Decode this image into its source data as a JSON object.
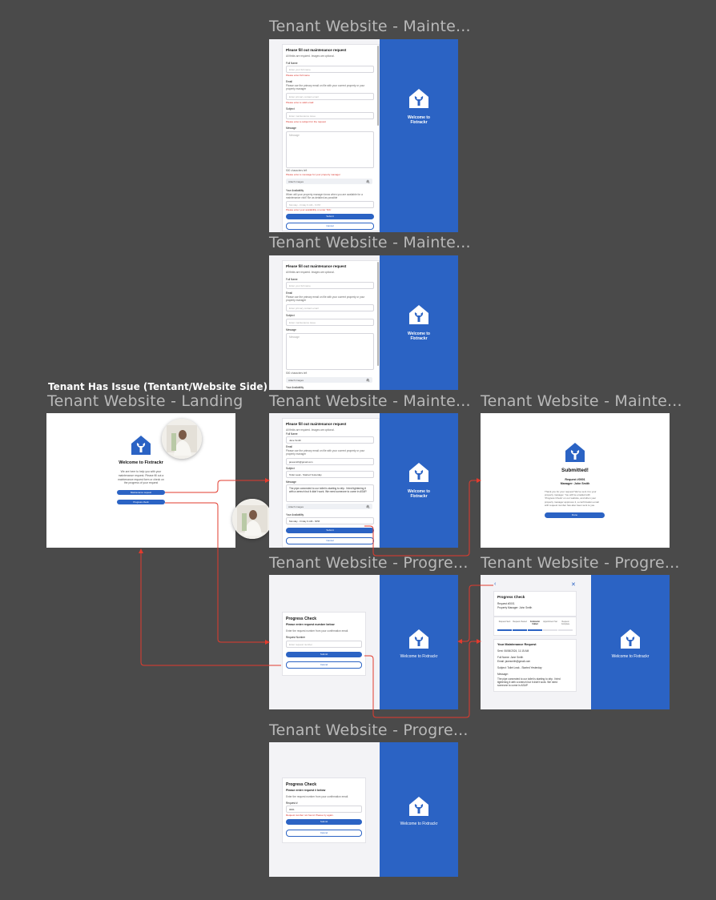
{
  "section_title": "Tenant Has Issue (Tentant/Website Side)",
  "frames": {
    "maint1": "Tenant Website - Mainte...",
    "maint2": "Tenant Website - Mainte...",
    "landing": "Tenant Website - Landing",
    "maint3": "Tenant Website - Mainte...",
    "maint_submitted": "Tenant Website - Mainte...",
    "progress1": "Tenant Website - Progre...",
    "progress2": "Tenant Website - Progre...",
    "progress3": "Tenant Website - Progre..."
  },
  "brand": {
    "welcome_line1": "Welcome to",
    "welcome_line2": "Fixtrackr",
    "welcome_full": "Welcome to Fixtrackr",
    "accent": "#2b63c4"
  },
  "landing": {
    "title": "Welcome to Fixtrackr",
    "body": [
      "We are here to help you with your",
      "maintenance request. Please fill out a",
      "maintenance request form or check on",
      "the progress of your request"
    ],
    "btn_request": "Maintenance request",
    "btn_progress": "Progress check"
  },
  "maint_form": {
    "heading": "Please fill out maintenance request",
    "subheading": "All fields are required. Images are optional.",
    "full_name_label": "Full Name",
    "full_name_placeholder": "Enter your full name",
    "full_name_error": "Please enter full name",
    "full_name_value": "Jane Smith",
    "email_label": "Email",
    "email_hint": "Please use the primary email on file with your current property or your property manager",
    "email_placeholder": "Enter primary contact email",
    "email_error": "Please enter a valid email",
    "email_value": "janesmith@gmail.com",
    "subject_label": "Subject",
    "subject_placeholder": "Enter maintenance issue",
    "subject_error": "Please enter a subject for the request",
    "subject_value": "Toilet Leak - Started Yesterday",
    "message_label": "Message",
    "message_placeholder": "Message",
    "message_value": "The pipe connected to our toilet is starting to drip. I tried tightening it with a wrench but it didn't work. We need someone to come in ASAP.",
    "char_count": "500 characters left",
    "message_error": "Please enter a message for your property manager",
    "attach_label": "Attach images",
    "availability_label": "Your Availability",
    "availability_hint": "When will your property manager know when you are available for a maintenance visit? Be as detailed as possible",
    "availability_placeholder": "Monday - Friday 9 AM - 6 PM",
    "availability_value": "Monday - Friday 9 AM - 6PM",
    "availability_error": "Please enter your availability or enter 'N/A'",
    "submit": "Submit",
    "cancel": "Cancel"
  },
  "submitted": {
    "title": "Submitted!",
    "request": "Request #0001",
    "manager": "Manager: John Smith",
    "body": [
      "Thank you for your request! We've sent it to your",
      "property manager. You will be emailed with",
      "'Progress Check' on our website, and when your",
      "property manager approves it, a confirmation email",
      "with request number has also been sent to you."
    ],
    "done": "Done"
  },
  "progress": {
    "heading": "Progress Check",
    "subheading": "Please enter request number below",
    "subheading_alt": "Please enter request # below",
    "hint": "Enter the request number from your confirmation email.",
    "label": "Request Number",
    "label_alt": "Request #",
    "placeholder": "Enter request number",
    "error_value": "0001",
    "error": "Request number not found. Please try again.",
    "submit": "Submit",
    "cancel": "Cancel"
  },
  "progress_detail": {
    "heading": "Progress Check",
    "request": "Request #0001",
    "manager": "Property Manager: John Smith",
    "steps": [
      "Request Sent",
      "Request Viewed",
      "Contractor Called",
      "Appointment Set",
      "Request Complete"
    ],
    "steps_done": 3,
    "section": "Your Maintenance Request",
    "sent": "Sent: 06/06/2024, 11:15 AM",
    "name": "Full Name: Jane Smith",
    "email": "Email: janesmith@gmail.com",
    "subject": "Subject: Toilet Leak - Started Yesterday",
    "message_label": "Message:",
    "message": [
      "The pipe connected to our toilet is starting to drip. I tried",
      "tightening it with a wrench but it didn't work. We need",
      "someone to come in ASAP."
    ]
  }
}
